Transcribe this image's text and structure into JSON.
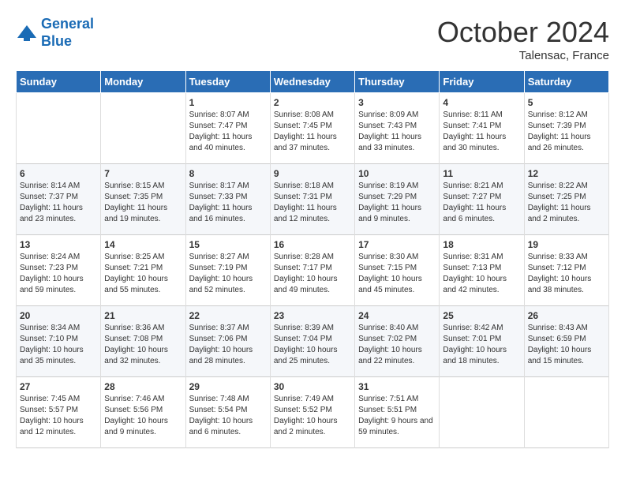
{
  "logo": {
    "line1": "General",
    "line2": "Blue"
  },
  "header": {
    "month": "October 2024",
    "location": "Talensac, France"
  },
  "days_of_week": [
    "Sunday",
    "Monday",
    "Tuesday",
    "Wednesday",
    "Thursday",
    "Friday",
    "Saturday"
  ],
  "weeks": [
    [
      {
        "day": "",
        "content": ""
      },
      {
        "day": "",
        "content": ""
      },
      {
        "day": "1",
        "content": "Sunrise: 8:07 AM\nSunset: 7:47 PM\nDaylight: 11 hours and 40 minutes."
      },
      {
        "day": "2",
        "content": "Sunrise: 8:08 AM\nSunset: 7:45 PM\nDaylight: 11 hours and 37 minutes."
      },
      {
        "day": "3",
        "content": "Sunrise: 8:09 AM\nSunset: 7:43 PM\nDaylight: 11 hours and 33 minutes."
      },
      {
        "day": "4",
        "content": "Sunrise: 8:11 AM\nSunset: 7:41 PM\nDaylight: 11 hours and 30 minutes."
      },
      {
        "day": "5",
        "content": "Sunrise: 8:12 AM\nSunset: 7:39 PM\nDaylight: 11 hours and 26 minutes."
      }
    ],
    [
      {
        "day": "6",
        "content": "Sunrise: 8:14 AM\nSunset: 7:37 PM\nDaylight: 11 hours and 23 minutes."
      },
      {
        "day": "7",
        "content": "Sunrise: 8:15 AM\nSunset: 7:35 PM\nDaylight: 11 hours and 19 minutes."
      },
      {
        "day": "8",
        "content": "Sunrise: 8:17 AM\nSunset: 7:33 PM\nDaylight: 11 hours and 16 minutes."
      },
      {
        "day": "9",
        "content": "Sunrise: 8:18 AM\nSunset: 7:31 PM\nDaylight: 11 hours and 12 minutes."
      },
      {
        "day": "10",
        "content": "Sunrise: 8:19 AM\nSunset: 7:29 PM\nDaylight: 11 hours and 9 minutes."
      },
      {
        "day": "11",
        "content": "Sunrise: 8:21 AM\nSunset: 7:27 PM\nDaylight: 11 hours and 6 minutes."
      },
      {
        "day": "12",
        "content": "Sunrise: 8:22 AM\nSunset: 7:25 PM\nDaylight: 11 hours and 2 minutes."
      }
    ],
    [
      {
        "day": "13",
        "content": "Sunrise: 8:24 AM\nSunset: 7:23 PM\nDaylight: 10 hours and 59 minutes."
      },
      {
        "day": "14",
        "content": "Sunrise: 8:25 AM\nSunset: 7:21 PM\nDaylight: 10 hours and 55 minutes."
      },
      {
        "day": "15",
        "content": "Sunrise: 8:27 AM\nSunset: 7:19 PM\nDaylight: 10 hours and 52 minutes."
      },
      {
        "day": "16",
        "content": "Sunrise: 8:28 AM\nSunset: 7:17 PM\nDaylight: 10 hours and 49 minutes."
      },
      {
        "day": "17",
        "content": "Sunrise: 8:30 AM\nSunset: 7:15 PM\nDaylight: 10 hours and 45 minutes."
      },
      {
        "day": "18",
        "content": "Sunrise: 8:31 AM\nSunset: 7:13 PM\nDaylight: 10 hours and 42 minutes."
      },
      {
        "day": "19",
        "content": "Sunrise: 8:33 AM\nSunset: 7:12 PM\nDaylight: 10 hours and 38 minutes."
      }
    ],
    [
      {
        "day": "20",
        "content": "Sunrise: 8:34 AM\nSunset: 7:10 PM\nDaylight: 10 hours and 35 minutes."
      },
      {
        "day": "21",
        "content": "Sunrise: 8:36 AM\nSunset: 7:08 PM\nDaylight: 10 hours and 32 minutes."
      },
      {
        "day": "22",
        "content": "Sunrise: 8:37 AM\nSunset: 7:06 PM\nDaylight: 10 hours and 28 minutes."
      },
      {
        "day": "23",
        "content": "Sunrise: 8:39 AM\nSunset: 7:04 PM\nDaylight: 10 hours and 25 minutes."
      },
      {
        "day": "24",
        "content": "Sunrise: 8:40 AM\nSunset: 7:02 PM\nDaylight: 10 hours and 22 minutes."
      },
      {
        "day": "25",
        "content": "Sunrise: 8:42 AM\nSunset: 7:01 PM\nDaylight: 10 hours and 18 minutes."
      },
      {
        "day": "26",
        "content": "Sunrise: 8:43 AM\nSunset: 6:59 PM\nDaylight: 10 hours and 15 minutes."
      }
    ],
    [
      {
        "day": "27",
        "content": "Sunrise: 7:45 AM\nSunset: 5:57 PM\nDaylight: 10 hours and 12 minutes."
      },
      {
        "day": "28",
        "content": "Sunrise: 7:46 AM\nSunset: 5:56 PM\nDaylight: 10 hours and 9 minutes."
      },
      {
        "day": "29",
        "content": "Sunrise: 7:48 AM\nSunset: 5:54 PM\nDaylight: 10 hours and 6 minutes."
      },
      {
        "day": "30",
        "content": "Sunrise: 7:49 AM\nSunset: 5:52 PM\nDaylight: 10 hours and 2 minutes."
      },
      {
        "day": "31",
        "content": "Sunrise: 7:51 AM\nSunset: 5:51 PM\nDaylight: 9 hours and 59 minutes."
      },
      {
        "day": "",
        "content": ""
      },
      {
        "day": "",
        "content": ""
      }
    ]
  ]
}
